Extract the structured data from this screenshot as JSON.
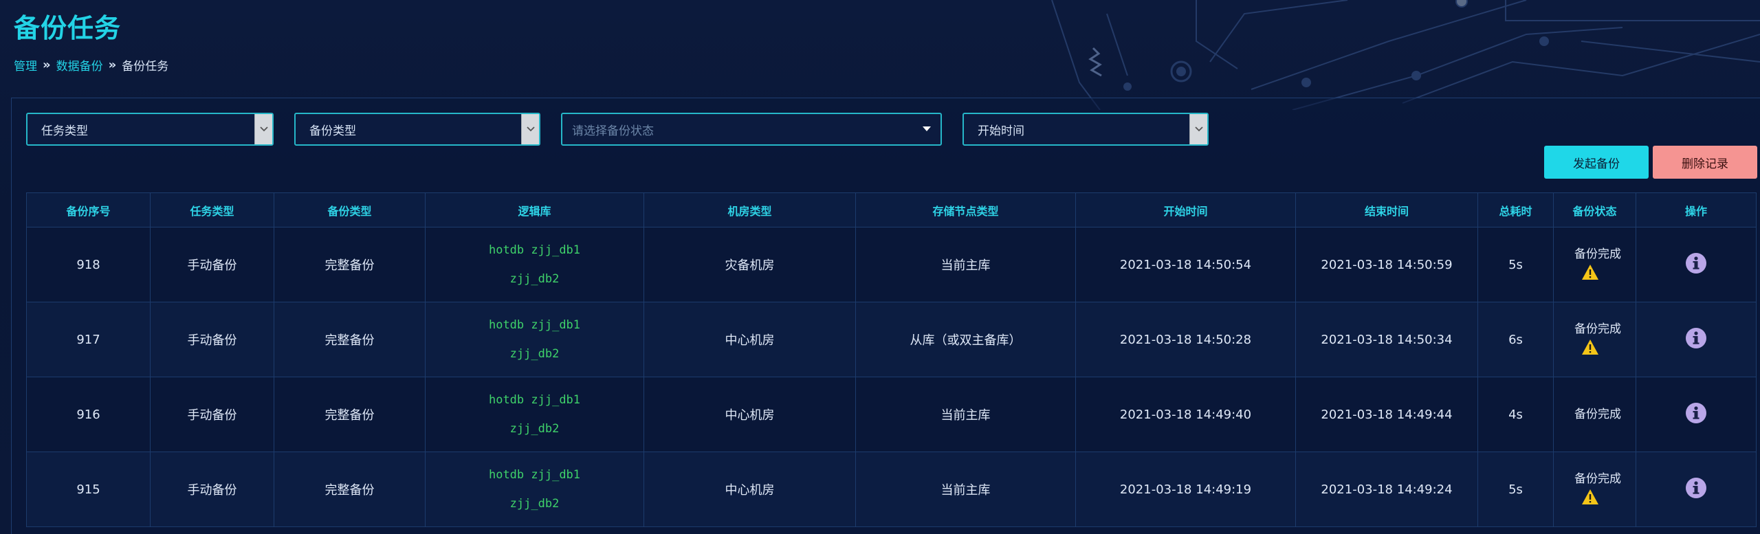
{
  "page": {
    "title": "备份任务",
    "breadcrumb": [
      {
        "label": "管理"
      },
      {
        "label": "数据备份"
      },
      {
        "label": "备份任务"
      }
    ],
    "breadcrumb_separator": "»"
  },
  "filters": {
    "task_type": {
      "label": "任务类型"
    },
    "backup_type": {
      "label": "备份类型"
    },
    "backup_status": {
      "placeholder": "请选择备份状态"
    },
    "start_time": {
      "label": "开始时间"
    }
  },
  "actions": {
    "start_backup": "发起备份",
    "delete_records": "删除记录"
  },
  "table": {
    "columns": [
      "备份序号",
      "任务类型",
      "备份类型",
      "逻辑库",
      "机房类型",
      "存储节点类型",
      "开始时间",
      "结束时间",
      "总耗时",
      "备份状态",
      "操作"
    ],
    "rows": [
      {
        "id": "918",
        "task_type": "手动备份",
        "backup_type": "完整备份",
        "db_line1": "hotdb  zjj_db1",
        "db_line2": "zjj_db2",
        "room_type": "灾备机房",
        "node_type": "当前主库",
        "start": "2021-03-18 14:50:54",
        "end": "2021-03-18 14:50:59",
        "duration": "5s",
        "status": "备份完成",
        "warning": true
      },
      {
        "id": "917",
        "task_type": "手动备份",
        "backup_type": "完整备份",
        "db_line1": "hotdb  zjj_db1",
        "db_line2": "zjj_db2",
        "room_type": "中心机房",
        "node_type": "从库（或双主备库）",
        "start": "2021-03-18 14:50:28",
        "end": "2021-03-18 14:50:34",
        "duration": "6s",
        "status": "备份完成",
        "warning": true
      },
      {
        "id": "916",
        "task_type": "手动备份",
        "backup_type": "完整备份",
        "db_line1": "hotdb  zjj_db1",
        "db_line2": "zjj_db2",
        "room_type": "中心机房",
        "node_type": "当前主库",
        "start": "2021-03-18 14:49:40",
        "end": "2021-03-18 14:49:44",
        "duration": "4s",
        "status": "备份完成",
        "warning": false
      },
      {
        "id": "915",
        "task_type": "手动备份",
        "backup_type": "完整备份",
        "db_line1": "hotdb  zjj_db1",
        "db_line2": "zjj_db2",
        "room_type": "中心机房",
        "node_type": "当前主库",
        "start": "2021-03-18 14:49:19",
        "end": "2021-03-18 14:49:24",
        "duration": "5s",
        "status": "备份完成",
        "warning": true
      }
    ]
  },
  "colors": {
    "accent": "#23d3e6",
    "primary_button": "#1fd7e8",
    "danger_button": "#f59492",
    "db_text": "#3fd26a",
    "warning": "#f5c518",
    "info_icon": "#b9a6e8"
  },
  "icons": {
    "warning": "warning-triangle-icon",
    "info": "info-circle-icon",
    "dropdown": "chevron-down-icon"
  }
}
